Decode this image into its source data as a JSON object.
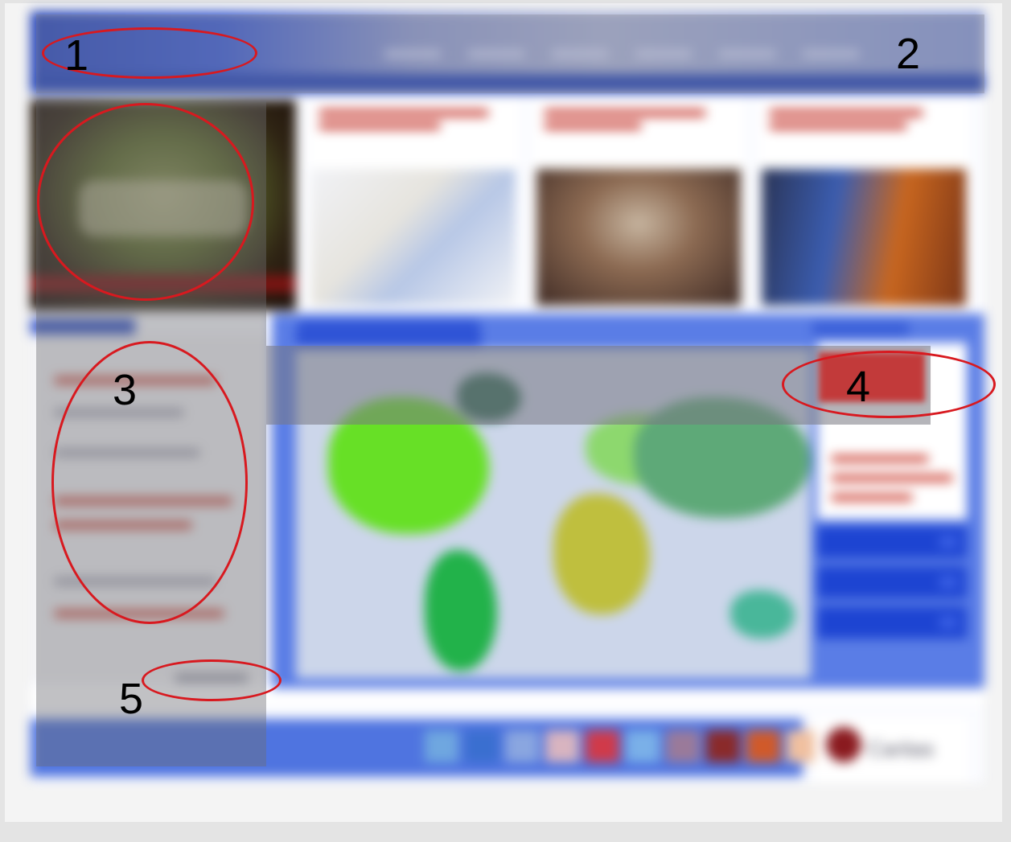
{
  "page": {
    "header": {
      "logo_text": ""
    }
  },
  "annotations": {
    "labels": [
      "1",
      "2",
      "3",
      "4",
      "5"
    ]
  },
  "partner_logo": {
    "text": "Caritas"
  },
  "colors": {
    "header_blue": "#2142b5",
    "annotation_red": "#d8191f",
    "headline_red": "#c9433a"
  }
}
